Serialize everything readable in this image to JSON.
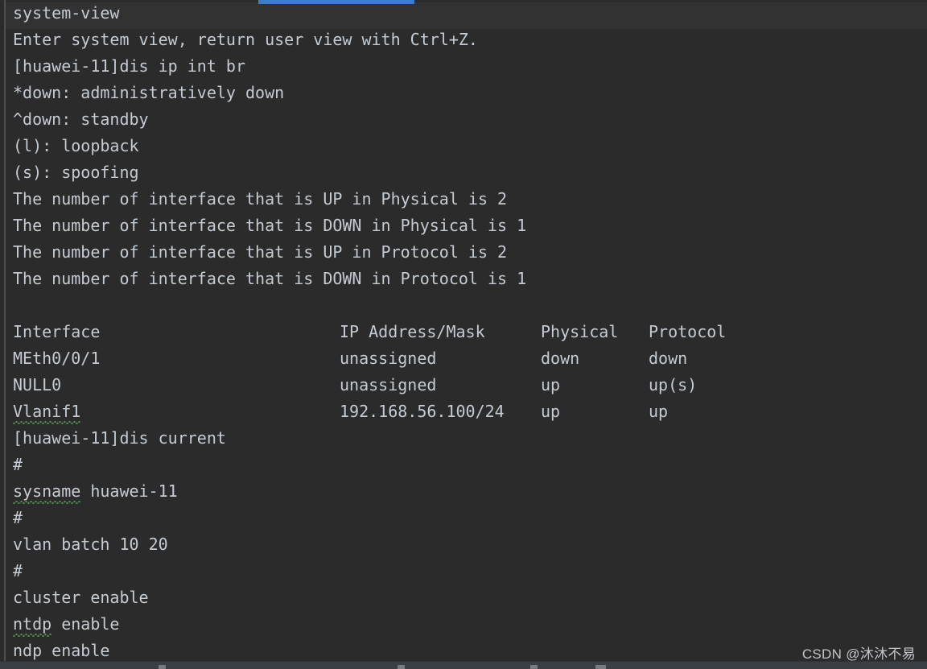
{
  "window": {
    "title": "system-view",
    "accent_color": "#3d7cc9",
    "background_color": "#2b2b2b",
    "text_color": "#c5cbd2",
    "current_line_color": "#323232",
    "squiggle_color": "#4e8a4e"
  },
  "console": {
    "prompt_host": "huawei-11",
    "lines": [
      {
        "id": "l01",
        "text": "system-view",
        "kind": "command-echo",
        "current": true
      },
      {
        "id": "l02",
        "text": "Enter system view, return user view with Ctrl+Z.",
        "kind": "output"
      },
      {
        "id": "l03",
        "text": "[huawei-11]dis ip int br",
        "kind": "prompt"
      },
      {
        "id": "l04",
        "text": "*down: administratively down",
        "kind": "legend"
      },
      {
        "id": "l05",
        "text": "^down: standby",
        "kind": "legend"
      },
      {
        "id": "l06",
        "text": "(l): loopback",
        "kind": "legend"
      },
      {
        "id": "l07",
        "text": "(s): spoofing",
        "kind": "legend"
      },
      {
        "id": "l08",
        "text": "The number of interface that is UP in Physical is 2",
        "kind": "summary"
      },
      {
        "id": "l09",
        "text": "The number of interface that is DOWN in Physical is 1",
        "kind": "summary"
      },
      {
        "id": "l10",
        "text": "The number of interface that is UP in Protocol is 2",
        "kind": "summary"
      },
      {
        "id": "l11",
        "text": "The number of interface that is DOWN in Protocol is 1",
        "kind": "summary"
      },
      {
        "id": "l12",
        "text": "",
        "kind": "blank"
      }
    ],
    "tail_lines": [
      {
        "id": "t01",
        "text": "[huawei-11]dis current",
        "kind": "prompt"
      },
      {
        "id": "t02",
        "text": "#",
        "kind": "output"
      },
      {
        "id": "t03",
        "text": "sysname huawei-11",
        "kind": "output",
        "squiggle_word": "sysname"
      },
      {
        "id": "t04",
        "text": "#",
        "kind": "output"
      },
      {
        "id": "t05",
        "text": "vlan batch 10 20",
        "kind": "output"
      },
      {
        "id": "t06",
        "text": "#",
        "kind": "output"
      },
      {
        "id": "t07",
        "text": "cluster enable",
        "kind": "output"
      },
      {
        "id": "t08",
        "text": "ntdp enable",
        "kind": "output",
        "squiggle_word": "ntdp"
      },
      {
        "id": "t09",
        "text": "ndp enable",
        "kind": "output",
        "clipped": true
      }
    ]
  },
  "interface_table": {
    "headers": {
      "interface": "Interface",
      "ip": "IP Address/Mask",
      "physical": "Physical",
      "protocol": "Protocol"
    },
    "rows": [
      {
        "interface": "MEth0/0/1",
        "ip": "unassigned",
        "physical": "down",
        "protocol": "down",
        "squiggle": false
      },
      {
        "interface": "NULL0",
        "ip": "unassigned",
        "physical": "up",
        "protocol": "up(s)",
        "squiggle": false
      },
      {
        "interface": "Vlanif1",
        "ip": "192.168.56.100/24",
        "physical": "up",
        "protocol": "up",
        "squiggle": true
      }
    ]
  },
  "watermark": {
    "text": "CSDN @沐沐不易"
  }
}
